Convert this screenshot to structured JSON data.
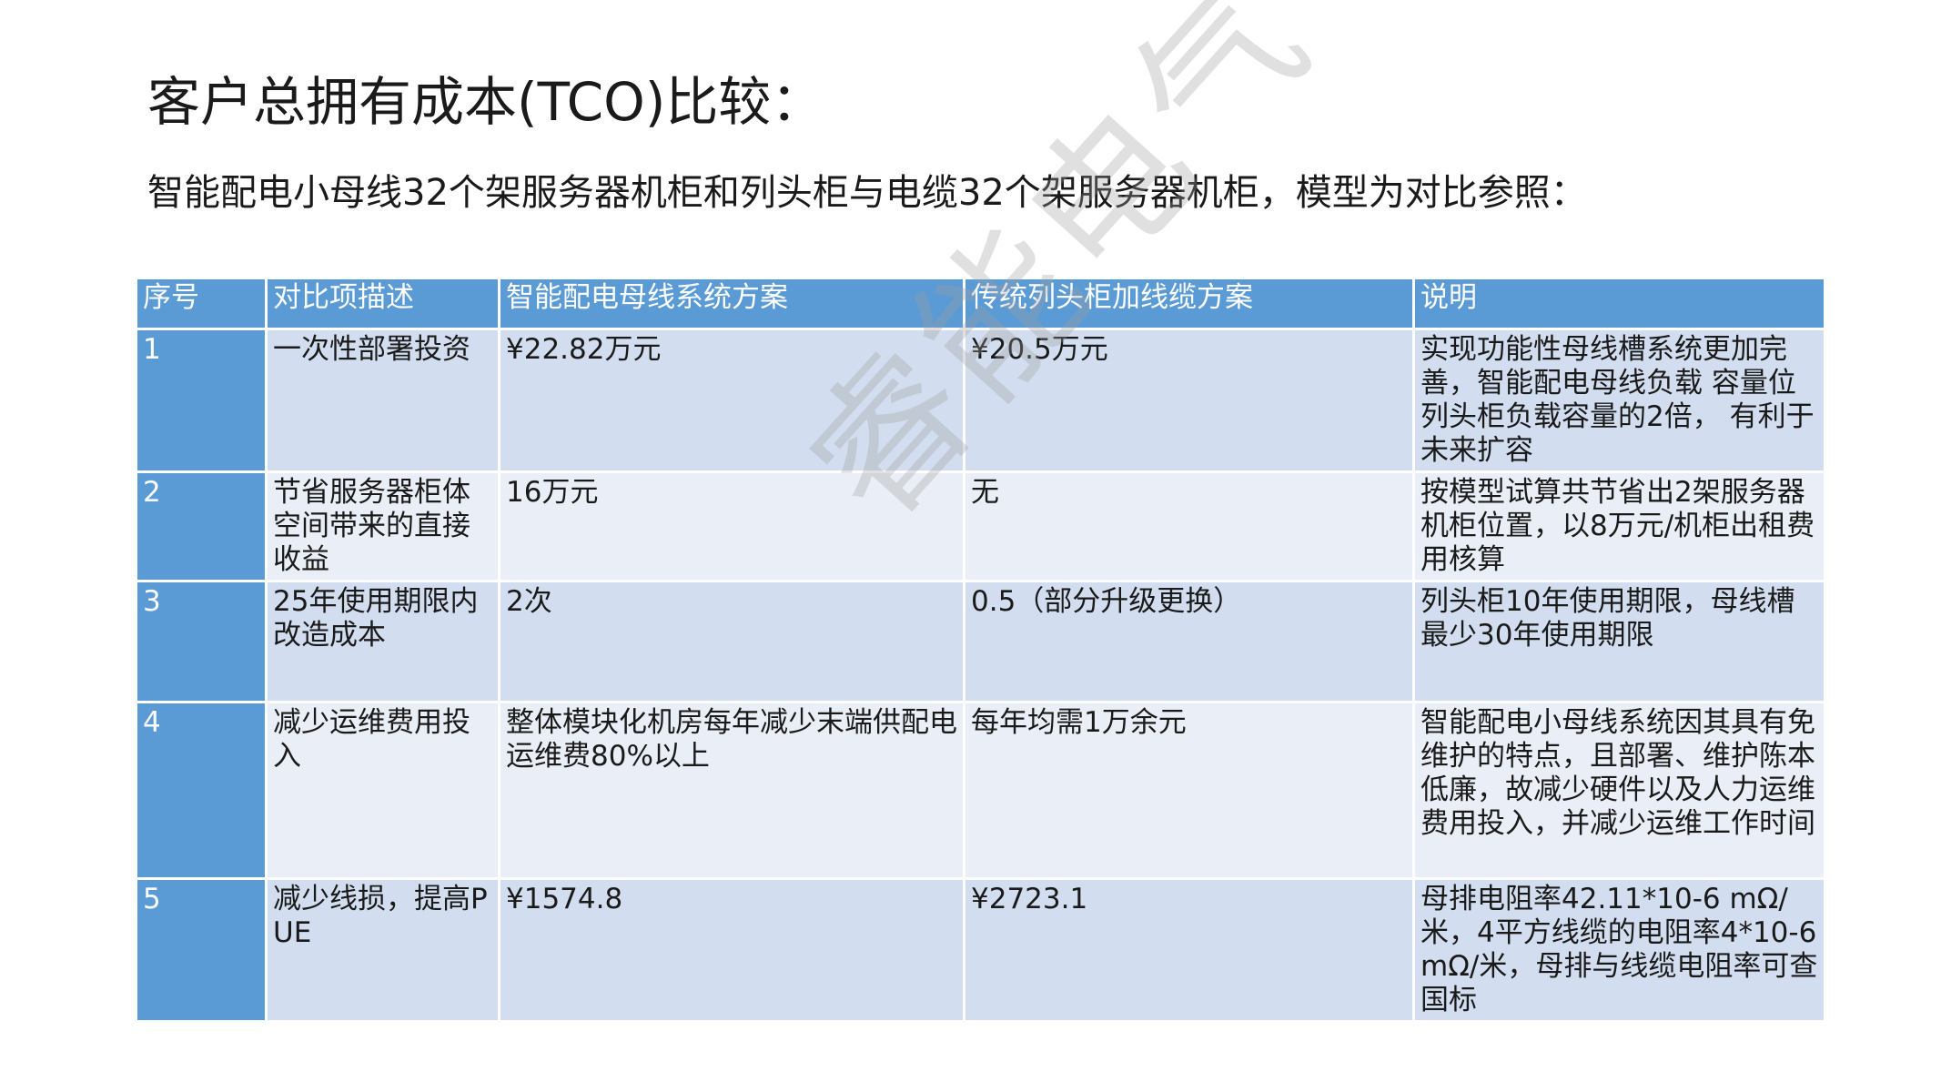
{
  "title": "客户总拥有成本(TCO)比较：",
  "subtitle": "智能配电小母线32个架服务器机柜和列头柜与电缆32个架服务器机柜，模型为对比参照：",
  "watermark": "睿能电气",
  "colors": {
    "header_bg": "#5b9bd5",
    "row_dark": "#d2deef",
    "row_light": "#eaeff7",
    "header_text": "#ffffff"
  },
  "table": {
    "headers": [
      "序号",
      "对比项描述",
      "智能配电母线系统方案",
      "传统列头柜加线缆方案",
      "说明"
    ],
    "rows": [
      {
        "no": "1",
        "item": "一次性部署投资",
        "busway": "¥22.82万元",
        "traditional": "¥20.5万元",
        "note": "实现功能性母线槽系统更加完善，智能配电母线负载 容量位列头柜负载容量的2倍， 有利于未来扩容"
      },
      {
        "no": "2",
        "item": "节省服务器柜体空间带来的直接收益",
        "busway": "16万元",
        "traditional": "无",
        "note": "按模型试算共节省出2架服务器机柜位置，以8万元/机柜出租费用核算"
      },
      {
        "no": "3",
        "item": "25年使用期限内改造成本",
        "busway": "2次",
        "traditional": "0.5（部分升级更换）",
        "note": "列头柜10年使用期限，母线槽最少30年使用期限"
      },
      {
        "no": "4",
        "item": "减少运维费用投入",
        "busway": "整体模块化机房每年减少末端供配电运维费80%以上",
        "traditional": "每年均需1万余元",
        "note": "智能配电小母线系统因其具有免维护的特点，且部署、维护陈本低廉，故减少硬件以及人力运维费用投入，并减少运维工作时间"
      },
      {
        "no": "5",
        "item": "减少线损，提高PUE",
        "busway": "¥1574.8",
        "traditional": "¥2723.1",
        "note": "母排电阻率42.11*10-6 mΩ/米，4平方线缆的电阻率4*10-6 mΩ/米，母排与线缆电阻率可查国标"
      }
    ]
  }
}
